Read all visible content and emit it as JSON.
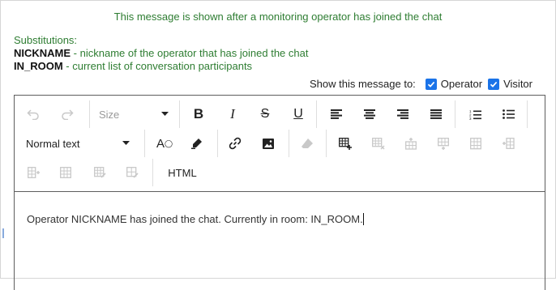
{
  "header_message": "This message is shown after a monitoring operator has joined the chat",
  "substitutions": {
    "title": "Substitutions:",
    "items": [
      {
        "key": "NICKNAME",
        "desc": " - nickname of the operator that has joined the chat"
      },
      {
        "key": "IN_ROOM",
        "desc": " - current list of conversation participants"
      }
    ]
  },
  "show_to": {
    "label": "Show this message to:",
    "options": [
      {
        "label": "Operator",
        "checked": true
      },
      {
        "label": "Visitor",
        "checked": true
      }
    ]
  },
  "toolbar": {
    "size_label": "Size",
    "format_label": "Normal text",
    "html_label": "HTML"
  },
  "editor_content": "Operator NICKNAME has joined the chat. Currently in room: IN_ROOM.",
  "colors": {
    "accent": "#1a73e8",
    "header_text": "#2e7d32",
    "disabled_icon": "#c8c8c8"
  }
}
